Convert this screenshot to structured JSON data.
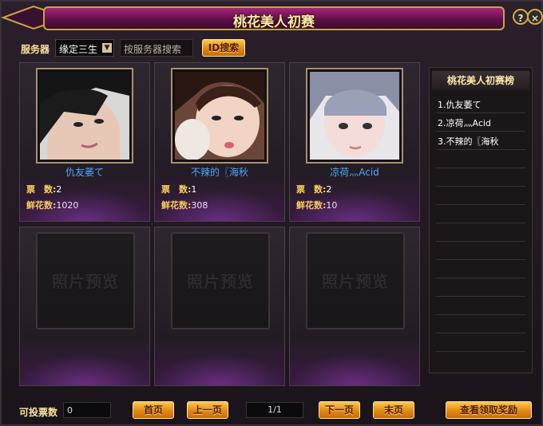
{
  "window": {
    "title": "桃花美人初赛",
    "help_label": "?",
    "close_label": "×"
  },
  "toolbar": {
    "server_label": "服务器",
    "server_value": "缘定三生",
    "search_placeholder": "按服务器搜索",
    "id_search_label": "ID搜索"
  },
  "cards": [
    {
      "name": "仇友萎て",
      "votes_label": "票　数:",
      "votes": "2",
      "flowers_label": "鲜花数:",
      "flowers": "1020"
    },
    {
      "name": "不辣的〖海秋",
      "votes_label": "票　数:",
      "votes": "1",
      "flowers_label": "鲜花数:",
      "flowers": "308"
    },
    {
      "name": "凉荷灬Acid",
      "votes_label": "票　数:",
      "votes": "2",
      "flowers_label": "鲜花数:",
      "flowers": "10"
    }
  ],
  "empty_card_text": "照片预览",
  "ranking": {
    "title": "桃花美人初赛榜",
    "items": [
      "1.仇友萎て",
      "2.凉荷灬Acid",
      "3.不辣的〖海秋"
    ]
  },
  "footer": {
    "votes_available_label": "可投票数",
    "votes_available_value": "0",
    "first_page": "首页",
    "prev_page": "上一页",
    "page_indicator": "1/1",
    "next_page": "下一页",
    "last_page": "末页",
    "view_reward": "查看领取奖励"
  },
  "colors": {
    "accent": "#ffc850",
    "name_blue": "#4aa8ff",
    "label_gold": "#ffd45a",
    "title_purple": "#a6247a"
  }
}
